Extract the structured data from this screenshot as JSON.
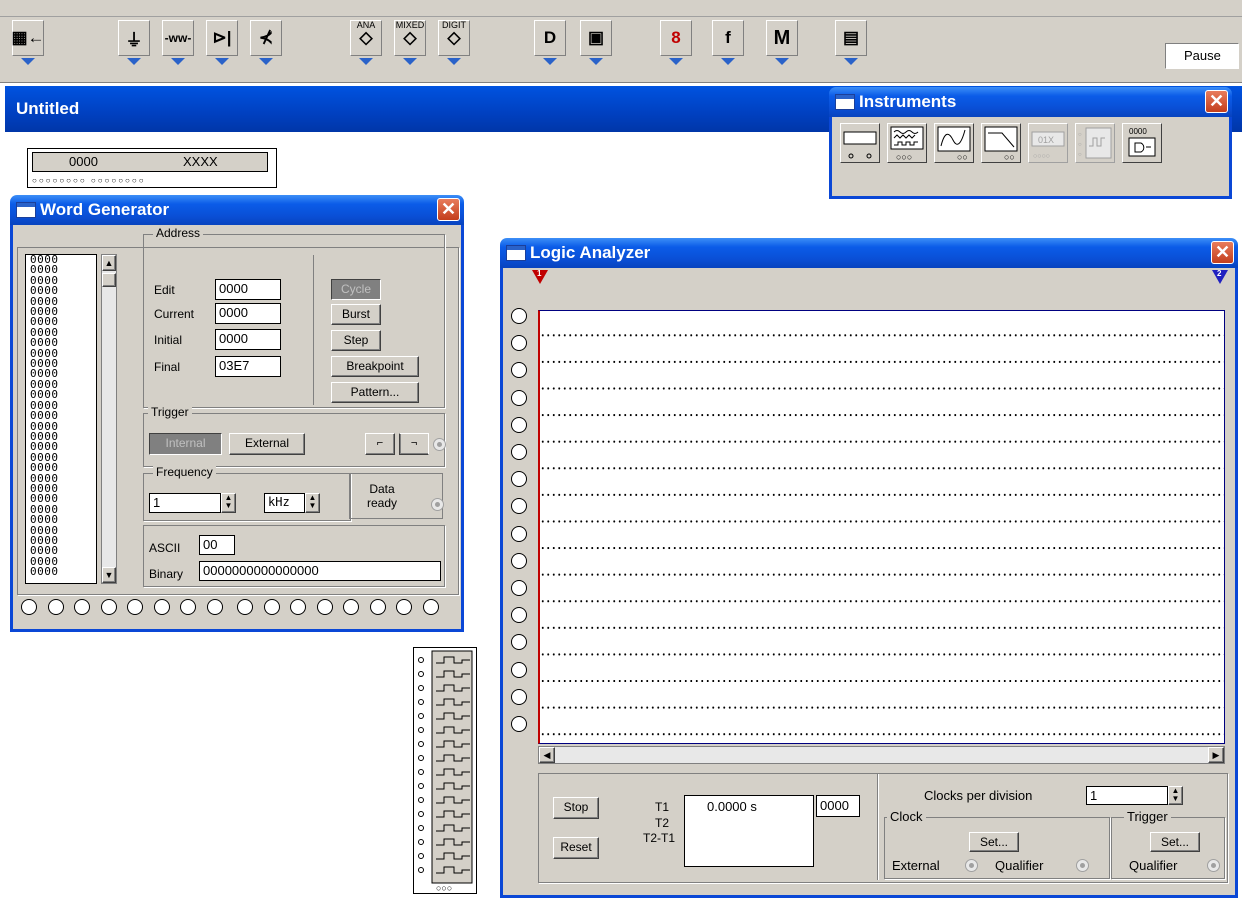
{
  "toolbar": {
    "buttons": [
      {
        "name": "parts-bin-button",
        "icon": "parts-bin-icon",
        "text": "▦←"
      },
      {
        "name": "sources-button",
        "icon": "ground-source-icon",
        "text": "⏚"
      },
      {
        "name": "basic-button",
        "icon": "resistor-icon",
        "text": "-ww-"
      },
      {
        "name": "diodes-button",
        "icon": "diode-icon",
        "text": "⊳|"
      },
      {
        "name": "transistors-button",
        "icon": "transistor-icon",
        "text": "⊀"
      },
      {
        "name": "analog-ics-button",
        "icon": "analog-ic-icon",
        "text": "◇",
        "label": "ANA"
      },
      {
        "name": "mixed-ics-button",
        "icon": "mixed-ic-icon",
        "text": "◇",
        "label": "MIXED"
      },
      {
        "name": "digital-ics-button",
        "icon": "digital-ic-icon",
        "text": "◇",
        "label": "DIGIT"
      },
      {
        "name": "logic-gates-button",
        "icon": "and-gate-icon",
        "text": "D"
      },
      {
        "name": "digital-button",
        "icon": "flipflop-icon",
        "text": "▣"
      },
      {
        "name": "indicators-button",
        "icon": "seven-segment-icon",
        "text": "8"
      },
      {
        "name": "controls-button",
        "icon": "function-icon",
        "text": "f"
      },
      {
        "name": "miscellaneous-button",
        "icon": "misc-icon",
        "text": "M"
      },
      {
        "name": "instruments-button",
        "icon": "instruments-icon",
        "text": "▤"
      }
    ],
    "pause_label": "Pause"
  },
  "circuit": {
    "title": "Untitled",
    "word_gen_component": {
      "left": "0000",
      "right": "XXXX"
    }
  },
  "instruments": {
    "title": "Instruments",
    "close": "✕",
    "items": [
      {
        "name": "multimeter-icon",
        "icon": "multimeter"
      },
      {
        "name": "function-generator-icon",
        "icon": "function-generator"
      },
      {
        "name": "oscilloscope-icon",
        "icon": "oscilloscope"
      },
      {
        "name": "bode-plotter-icon",
        "icon": "bode-plotter"
      },
      {
        "name": "word-generator-icon",
        "icon": "word-generator"
      },
      {
        "name": "logic-analyzer-icon",
        "icon": "logic-analyzer"
      },
      {
        "name": "logic-converter-icon",
        "icon": "logic-converter"
      }
    ],
    "converter_digits": "0000",
    "word_gen_digits": "01X"
  },
  "word_generator": {
    "title": "Word Generator",
    "close": "✕",
    "words": [
      "0000",
      "0000",
      "0000",
      "0000",
      "0000",
      "0000",
      "0000",
      "0000",
      "0000",
      "0000",
      "0000",
      "0000",
      "0000",
      "0000",
      "0000",
      "0000",
      "0000",
      "0000",
      "0000",
      "0000",
      "0000",
      "0000",
      "0000",
      "0000",
      "0000",
      "0000",
      "0000",
      "0000",
      "0000",
      "0000",
      "0000"
    ],
    "address": {
      "group": "Address",
      "edit_label": "Edit",
      "edit_value": "0000",
      "current_label": "Current",
      "current_value": "0000",
      "initial_label": "Initial",
      "initial_value": "0000",
      "final_label": "Final",
      "final_value": "03E7"
    },
    "buttons": {
      "cycle": "Cycle",
      "burst": "Burst",
      "step": "Step",
      "breakpoint": "Breakpoint",
      "pattern": "Pattern..."
    },
    "trigger": {
      "group": "Trigger",
      "internal": "Internal",
      "external": "External",
      "rising": "⌐",
      "falling": "⌐"
    },
    "frequency": {
      "group": "Frequency",
      "value": "1",
      "unit": "kHz"
    },
    "data_ready": "Data\nready",
    "ascii_label": "ASCII",
    "ascii_value": "00",
    "binary_label": "Binary",
    "binary_value": "0000000000000000"
  },
  "logic_analyzer": {
    "title": "Logic Analyzer",
    "close": "✕",
    "cursor1": "1",
    "cursor2": "2",
    "stop": "Stop",
    "reset": "Reset",
    "t1_label": "T1",
    "t2_label": "T2",
    "t21_label": "T2-T1",
    "time_value": "0.0000  s",
    "count_value": "0000",
    "clocks_per_division_label": "Clocks per division",
    "clocks_per_division_value": "1",
    "clock_group": "Clock",
    "trigger_group": "Trigger",
    "set_label": "Set...",
    "external_label": "External",
    "qualifier_label": "Qualifier"
  },
  "colors": {
    "titlebar": "#0a4fd6",
    "close_button": "#c33e1c",
    "toolbar_arrow": "#2a62c9",
    "cursor1": "#c00000",
    "cursor2": "#2020c0"
  }
}
